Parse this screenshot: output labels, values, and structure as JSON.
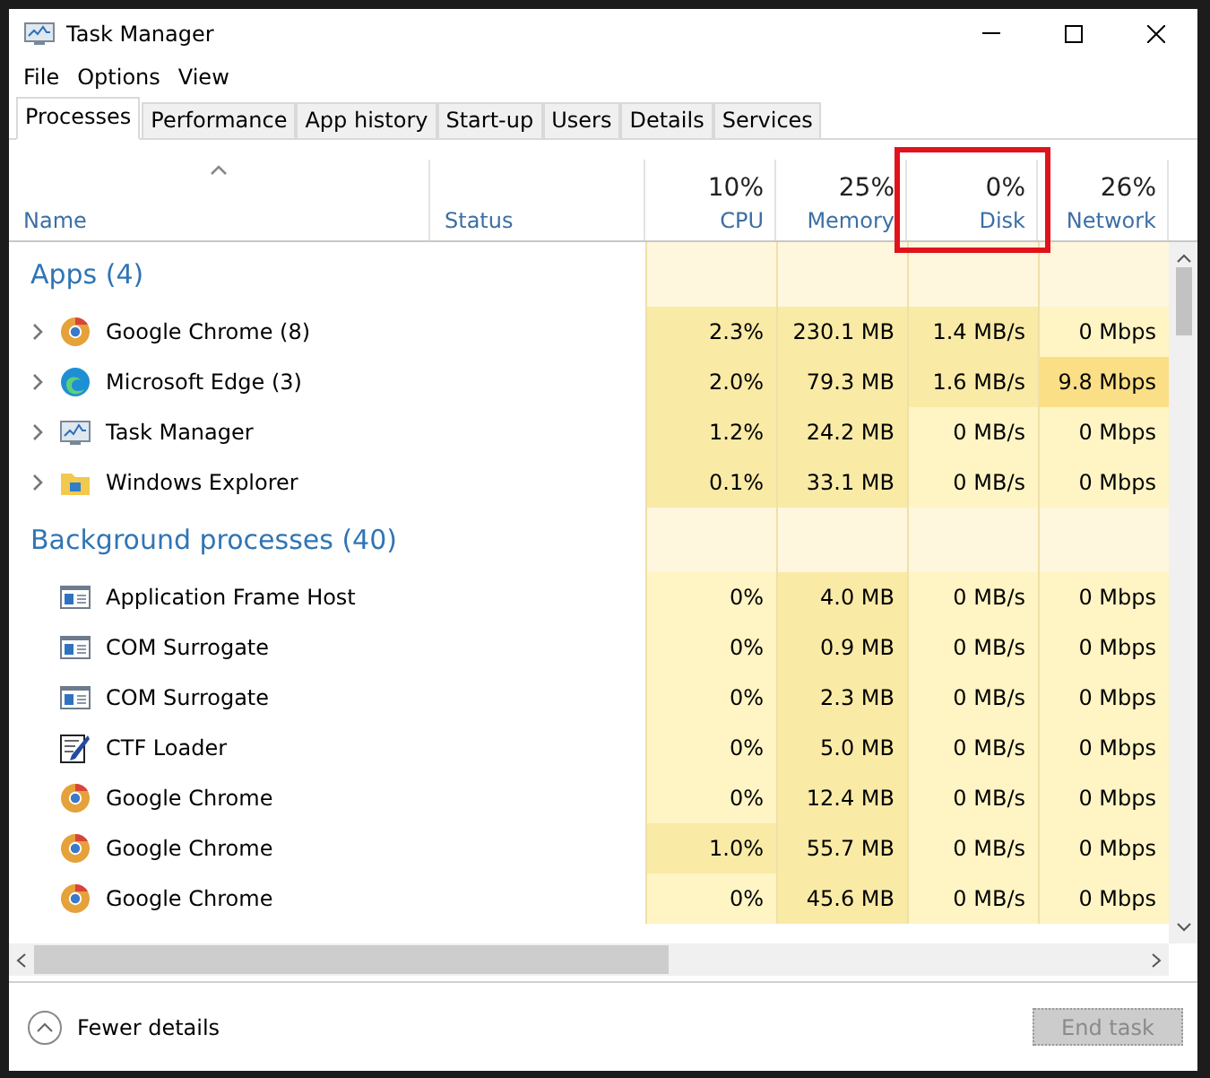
{
  "window": {
    "title": "Task Manager"
  },
  "menu": [
    "File",
    "Options",
    "View"
  ],
  "tabs": [
    {
      "label": "Processes",
      "selected": true
    },
    {
      "label": "Performance",
      "selected": false
    },
    {
      "label": "App history",
      "selected": false
    },
    {
      "label": "Start-up",
      "selected": false
    },
    {
      "label": "Users",
      "selected": false
    },
    {
      "label": "Details",
      "selected": false
    },
    {
      "label": "Services",
      "selected": false
    }
  ],
  "columns": [
    {
      "label": "Name",
      "sorted": true,
      "highlighted": false
    },
    {
      "label": "Status",
      "sorted": false,
      "highlighted": false
    },
    {
      "label": "CPU",
      "percent": "10%",
      "sorted": false,
      "highlighted": false
    },
    {
      "label": "Memory",
      "percent": "25%",
      "sorted": false,
      "highlighted": false
    },
    {
      "label": "Disk",
      "percent": "0%",
      "sorted": false,
      "highlighted": true
    },
    {
      "label": "Network",
      "percent": "26%",
      "sorted": false,
      "highlighted": false
    }
  ],
  "groups": [
    {
      "title": "Apps (4)",
      "rows": [
        {
          "name": "Google Chrome (8)",
          "kind": "chrome",
          "expandable": true,
          "cells": [
            {
              "text": "2.3%",
              "kind": "mid"
            },
            {
              "text": "230.1 MB",
              "kind": "mid"
            },
            {
              "text": "1.4 MB/s",
              "kind": "mid"
            },
            {
              "text": "0 Mbps",
              "kind": "low"
            }
          ]
        },
        {
          "name": "Microsoft Edge (3)",
          "kind": "edge",
          "expandable": true,
          "cells": [
            {
              "text": "2.0%",
              "kind": "mid"
            },
            {
              "text": "79.3 MB",
              "kind": "mid"
            },
            {
              "text": "1.6 MB/s",
              "kind": "mid"
            },
            {
              "text": "9.8 Mbps",
              "kind": "high"
            }
          ]
        },
        {
          "name": "Task Manager",
          "kind": "monitor",
          "expandable": true,
          "cells": [
            {
              "text": "1.2%",
              "kind": "mid"
            },
            {
              "text": "24.2 MB",
              "kind": "mid"
            },
            {
              "text": "0 MB/s",
              "kind": "low"
            },
            {
              "text": "0 Mbps",
              "kind": "low"
            }
          ]
        },
        {
          "name": "Windows Explorer",
          "kind": "folder",
          "expandable": true,
          "cells": [
            {
              "text": "0.1%",
              "kind": "mid"
            },
            {
              "text": "33.1 MB",
              "kind": "mid"
            },
            {
              "text": "0 MB/s",
              "kind": "low"
            },
            {
              "text": "0 Mbps",
              "kind": "low"
            }
          ]
        }
      ]
    },
    {
      "title": "Background processes (40)",
      "rows": [
        {
          "name": "Application Frame Host",
          "kind": "window",
          "expandable": false,
          "cells": [
            {
              "text": "0%",
              "kind": "low"
            },
            {
              "text": "4.0 MB",
              "kind": "mid"
            },
            {
              "text": "0 MB/s",
              "kind": "low"
            },
            {
              "text": "0 Mbps",
              "kind": "low"
            }
          ]
        },
        {
          "name": "COM Surrogate",
          "kind": "window",
          "expandable": false,
          "cells": [
            {
              "text": "0%",
              "kind": "low"
            },
            {
              "text": "0.9 MB",
              "kind": "mid"
            },
            {
              "text": "0 MB/s",
              "kind": "low"
            },
            {
              "text": "0 Mbps",
              "kind": "low"
            }
          ]
        },
        {
          "name": "COM Surrogate",
          "kind": "window",
          "expandable": false,
          "cells": [
            {
              "text": "0%",
              "kind": "low"
            },
            {
              "text": "2.3 MB",
              "kind": "mid"
            },
            {
              "text": "0 MB/s",
              "kind": "low"
            },
            {
              "text": "0 Mbps",
              "kind": "low"
            }
          ]
        },
        {
          "name": "CTF Loader",
          "kind": "notepad",
          "expandable": false,
          "cells": [
            {
              "text": "0%",
              "kind": "low"
            },
            {
              "text": "5.0 MB",
              "kind": "mid"
            },
            {
              "text": "0 MB/s",
              "kind": "low"
            },
            {
              "text": "0 Mbps",
              "kind": "low"
            }
          ]
        },
        {
          "name": "Google Chrome",
          "kind": "chrome",
          "expandable": false,
          "cells": [
            {
              "text": "0%",
              "kind": "low"
            },
            {
              "text": "12.4 MB",
              "kind": "mid"
            },
            {
              "text": "0 MB/s",
              "kind": "low"
            },
            {
              "text": "0 Mbps",
              "kind": "low"
            }
          ]
        },
        {
          "name": "Google Chrome",
          "kind": "chrome",
          "expandable": false,
          "cells": [
            {
              "text": "1.0%",
              "kind": "mid"
            },
            {
              "text": "55.7 MB",
              "kind": "mid"
            },
            {
              "text": "0 MB/s",
              "kind": "low"
            },
            {
              "text": "0 Mbps",
              "kind": "low"
            }
          ]
        },
        {
          "name": "Google Chrome",
          "kind": "chrome",
          "expandable": false,
          "cells": [
            {
              "text": "0%",
              "kind": "low"
            },
            {
              "text": "45.6 MB",
              "kind": "mid"
            },
            {
              "text": "0 MB/s",
              "kind": "low"
            },
            {
              "text": "0 Mbps",
              "kind": "low"
            }
          ]
        }
      ]
    }
  ],
  "footer": {
    "toggle": "Fewer details",
    "button": {
      "label": "End task",
      "disabled": true
    }
  }
}
